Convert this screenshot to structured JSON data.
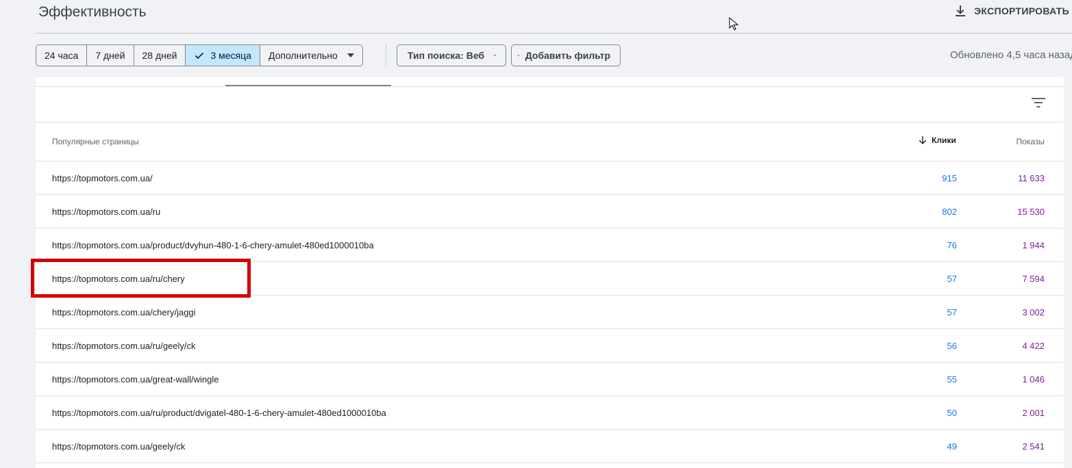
{
  "header": {
    "title": "Эффективность",
    "export_label": "ЭКСПОРТИРОВАТЬ"
  },
  "filters": {
    "date_ranges": [
      {
        "label": "24 часа",
        "selected": false
      },
      {
        "label": "7 дней",
        "selected": false
      },
      {
        "label": "28 дней",
        "selected": false
      },
      {
        "label": "3 месяца",
        "selected": true
      },
      {
        "label": "Дополнительно",
        "selected": false
      }
    ],
    "search_type_label": "Тип поиска: Веб",
    "add_filter_label": "Добавить фильтр",
    "updated_text": "Обновлено 4,5 часа назад"
  },
  "table": {
    "columns": {
      "pages": "Популярные страницы",
      "clicks": "Клики",
      "impressions": "Показы"
    },
    "sort": {
      "column": "clicks",
      "direction": "desc"
    },
    "rows": [
      {
        "url": "https://topmotors.com.ua/",
        "clicks": "915",
        "impressions": "11 633"
      },
      {
        "url": "https://topmotors.com.ua/ru",
        "clicks": "802",
        "impressions": "15 530"
      },
      {
        "url": "https://topmotors.com.ua/product/dvyhun-480-1-6-chery-amulet-480ed1000010ba",
        "clicks": "76",
        "impressions": "1 944"
      },
      {
        "url": "https://topmotors.com.ua/ru/chery",
        "clicks": "57",
        "impressions": "7 594"
      },
      {
        "url": "https://topmotors.com.ua/chery/jaggi",
        "clicks": "57",
        "impressions": "3 002"
      },
      {
        "url": "https://topmotors.com.ua/ru/geely/ck",
        "clicks": "56",
        "impressions": "4 422"
      },
      {
        "url": "https://topmotors.com.ua/great-wall/wingle",
        "clicks": "55",
        "impressions": "1 046"
      },
      {
        "url": "https://topmotors.com.ua/ru/product/dvigatel-480-1-6-chery-amulet-480ed1000010ba",
        "clicks": "50",
        "impressions": "2 001"
      },
      {
        "url": "https://topmotors.com.ua/geely/ck",
        "clicks": "49",
        "impressions": "2 541"
      }
    ]
  },
  "annotation": {
    "highlighted_row": 3,
    "color": "#d40000"
  },
  "colors": {
    "clicks": "#1a73e8",
    "impressions": "#7b1fa2",
    "selected_chip": "#c2e7ff"
  },
  "icons": {
    "export": "download-icon",
    "filter": "filter-list-icon",
    "sort": "arrow-down-icon",
    "selected": "check-icon",
    "add": "plus-icon"
  }
}
